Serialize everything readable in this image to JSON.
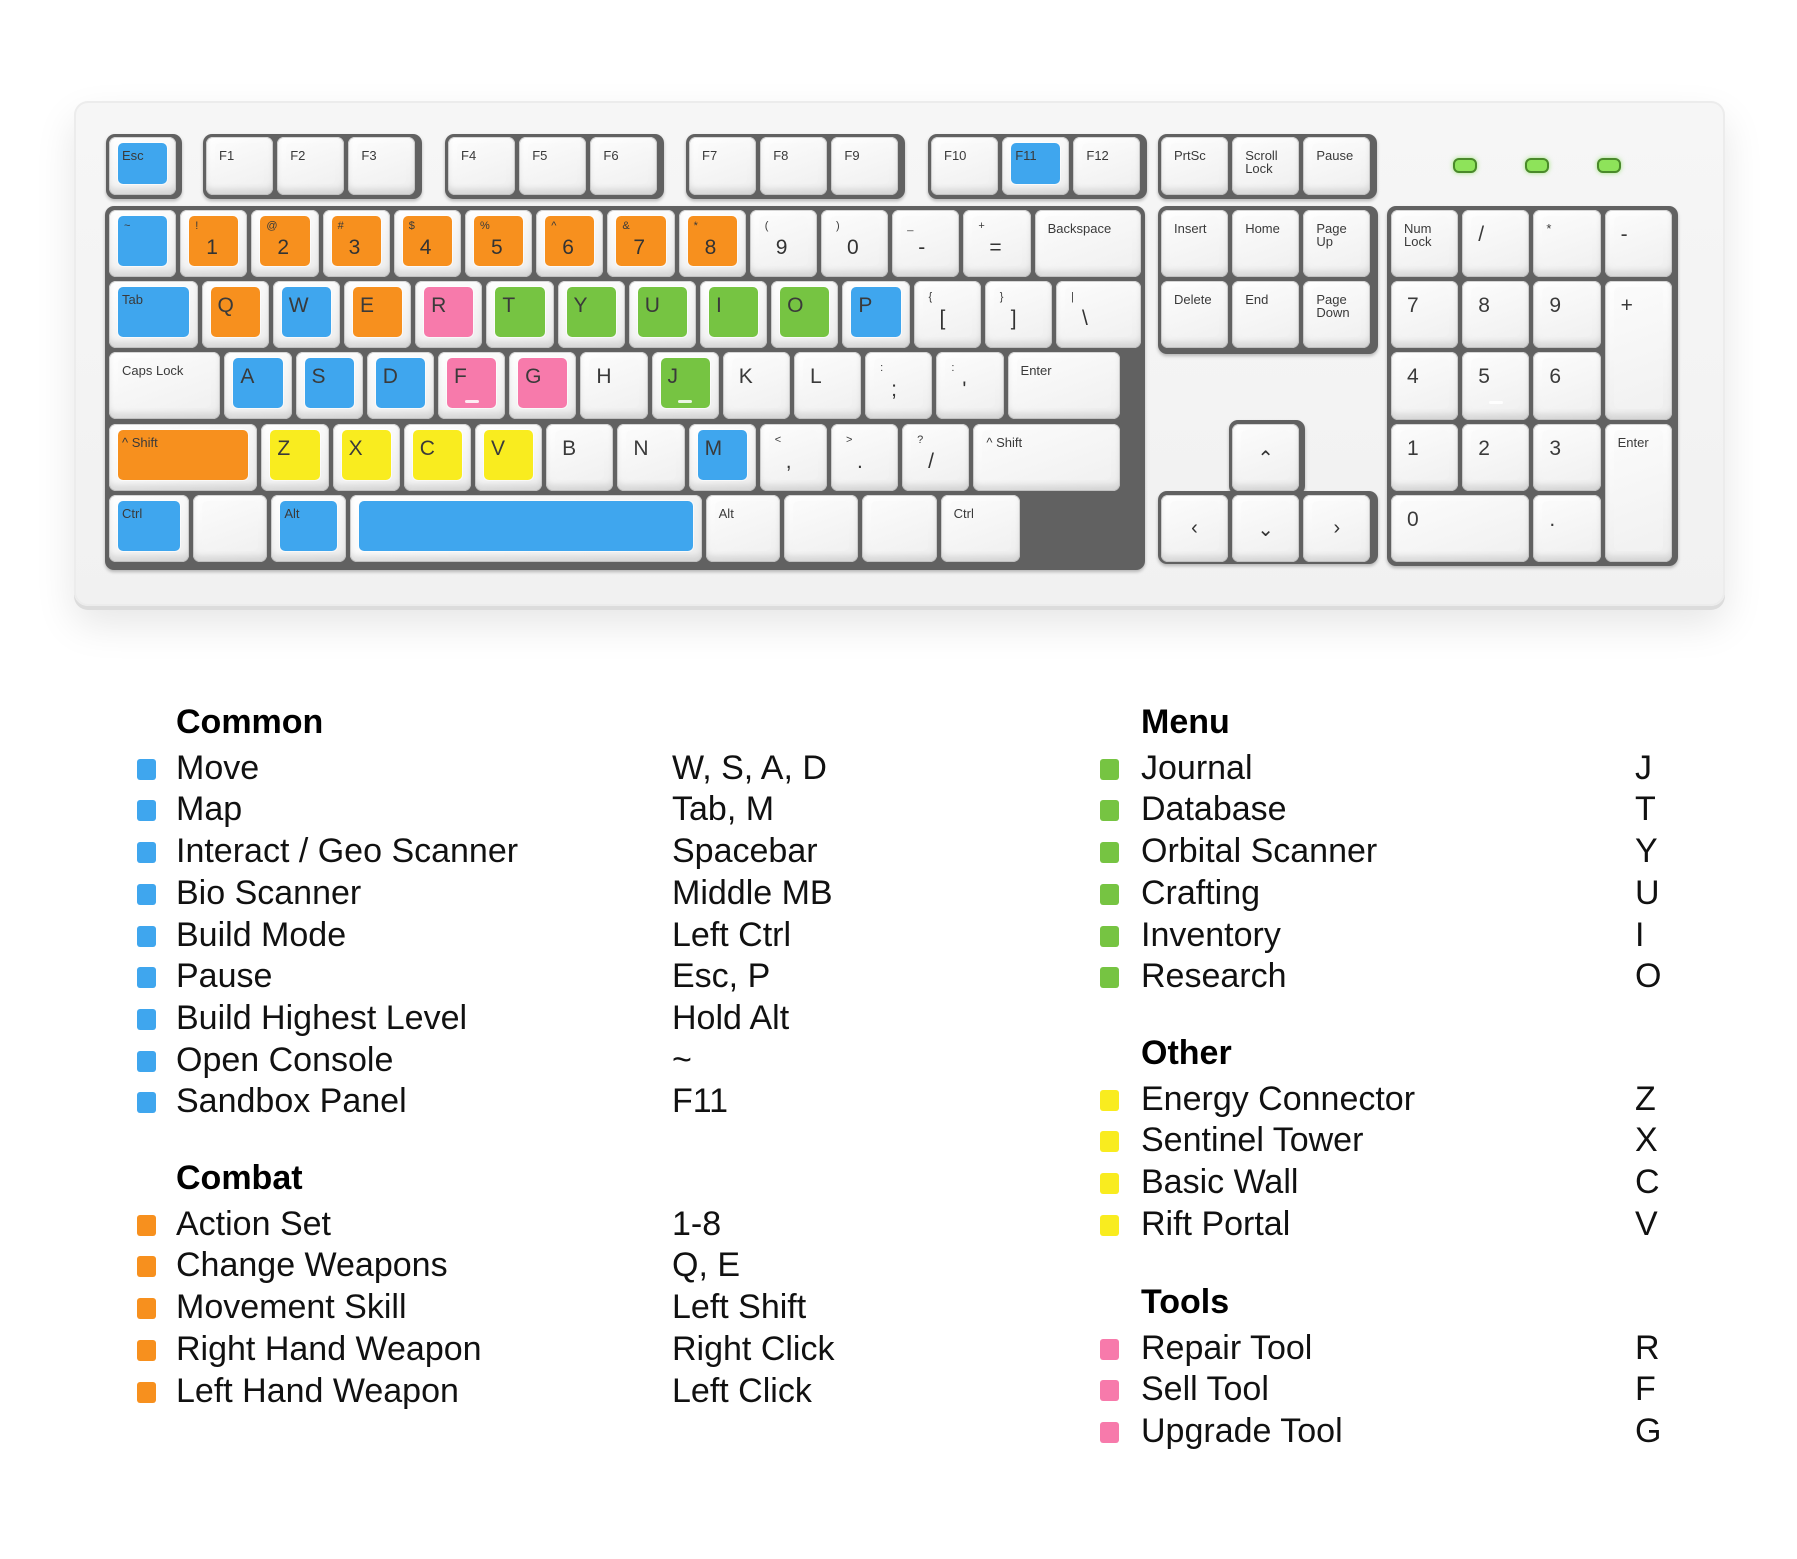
{
  "colors": {
    "blue": "#3fa6ee",
    "orange": "#f7901e",
    "green": "#76c442",
    "yellow": "#f9ec1f",
    "pink": "#f77aab",
    "default": ""
  },
  "keyboard": {
    "function_row": [
      {
        "id": "esc",
        "label": "Esc",
        "color": "blue"
      },
      {
        "id": "f1",
        "label": "F1"
      },
      {
        "id": "f2",
        "label": "F2"
      },
      {
        "id": "f3",
        "label": "F3"
      },
      {
        "id": "f4",
        "label": "F4"
      },
      {
        "id": "f5",
        "label": "F5"
      },
      {
        "id": "f6",
        "label": "F6"
      },
      {
        "id": "f7",
        "label": "F7"
      },
      {
        "id": "f8",
        "label": "F8"
      },
      {
        "id": "f9",
        "label": "F9"
      },
      {
        "id": "f10",
        "label": "F10"
      },
      {
        "id": "f11",
        "label": "F11",
        "color": "blue"
      },
      {
        "id": "f12",
        "label": "F12"
      },
      {
        "id": "prtsc",
        "label": "PrtSc"
      },
      {
        "id": "scroll-lock",
        "label": "Scroll\nLock"
      },
      {
        "id": "pause",
        "label": "Pause"
      }
    ],
    "number_row": [
      {
        "id": "tilde",
        "top": "~",
        "main": "",
        "color": "blue"
      },
      {
        "id": "1",
        "top": "!",
        "main": "1",
        "color": "orange"
      },
      {
        "id": "2",
        "top": "@",
        "main": "2",
        "color": "orange"
      },
      {
        "id": "3",
        "top": "#",
        "main": "3",
        "color": "orange"
      },
      {
        "id": "4",
        "top": "$",
        "main": "4",
        "color": "orange"
      },
      {
        "id": "5",
        "top": "%",
        "main": "5",
        "color": "orange"
      },
      {
        "id": "6",
        "top": "^",
        "main": "6",
        "color": "orange"
      },
      {
        "id": "7",
        "top": "&",
        "main": "7",
        "color": "orange"
      },
      {
        "id": "8",
        "top": "*",
        "main": "8",
        "color": "orange"
      },
      {
        "id": "9",
        "top": "(",
        "main": "9"
      },
      {
        "id": "0",
        "top": ")",
        "main": "0"
      },
      {
        "id": "minus",
        "top": "_",
        "main": "-"
      },
      {
        "id": "equals",
        "top": "+",
        "main": "="
      },
      {
        "id": "backspace",
        "label": "Backspace"
      }
    ],
    "qwerty_row": [
      {
        "id": "tab",
        "label": "Tab",
        "color": "blue"
      },
      {
        "id": "q",
        "big": "Q",
        "color": "orange"
      },
      {
        "id": "w",
        "big": "W",
        "color": "blue"
      },
      {
        "id": "e",
        "big": "E",
        "color": "orange"
      },
      {
        "id": "r",
        "big": "R",
        "color": "pink"
      },
      {
        "id": "t",
        "big": "T",
        "color": "green"
      },
      {
        "id": "y",
        "big": "Y",
        "color": "green"
      },
      {
        "id": "u",
        "big": "U",
        "color": "green"
      },
      {
        "id": "i",
        "big": "I",
        "color": "green"
      },
      {
        "id": "o",
        "big": "O",
        "color": "green"
      },
      {
        "id": "p",
        "big": "P",
        "color": "blue"
      },
      {
        "id": "lbracket",
        "top": "{",
        "main": "["
      },
      {
        "id": "rbracket",
        "top": "}",
        "main": "]"
      },
      {
        "id": "backslash",
        "top": "|",
        "main": "\\"
      }
    ],
    "home_row": [
      {
        "id": "caps-lock",
        "label": "Caps Lock"
      },
      {
        "id": "a",
        "big": "A",
        "color": "blue"
      },
      {
        "id": "s",
        "big": "S",
        "color": "blue"
      },
      {
        "id": "d",
        "big": "D",
        "color": "blue"
      },
      {
        "id": "f",
        "big": "F",
        "color": "pink",
        "bump": true
      },
      {
        "id": "g",
        "big": "G",
        "color": "pink"
      },
      {
        "id": "h",
        "big": "H"
      },
      {
        "id": "j",
        "big": "J",
        "color": "green",
        "bump": true
      },
      {
        "id": "k",
        "big": "K"
      },
      {
        "id": "l",
        "big": "L"
      },
      {
        "id": "semicolon",
        "top": ":",
        "main": ";"
      },
      {
        "id": "quote",
        "top": ":",
        "main": "'"
      },
      {
        "id": "enter",
        "label": "Enter"
      }
    ],
    "shift_row": [
      {
        "id": "left-shift",
        "label": "^ Shift",
        "color": "orange"
      },
      {
        "id": "z",
        "big": "Z",
        "color": "yellow"
      },
      {
        "id": "x",
        "big": "X",
        "color": "yellow"
      },
      {
        "id": "c",
        "big": "C",
        "color": "yellow"
      },
      {
        "id": "v",
        "big": "V",
        "color": "yellow"
      },
      {
        "id": "b",
        "big": "B"
      },
      {
        "id": "n",
        "big": "N"
      },
      {
        "id": "m",
        "big": "M",
        "color": "blue"
      },
      {
        "id": "comma",
        "top": "<",
        "main": ","
      },
      {
        "id": "period",
        "top": ">",
        "main": "."
      },
      {
        "id": "slash",
        "top": "?",
        "main": "/"
      },
      {
        "id": "right-shift",
        "label": "^ Shift"
      }
    ],
    "bottom_row": [
      {
        "id": "left-ctrl",
        "label": "Ctrl",
        "color": "blue"
      },
      {
        "id": "left-win",
        "label": ""
      },
      {
        "id": "left-alt",
        "label": "Alt",
        "color": "blue"
      },
      {
        "id": "spacebar",
        "label": "",
        "color": "blue"
      },
      {
        "id": "right-alt",
        "label": "Alt"
      },
      {
        "id": "right-win",
        "label": ""
      },
      {
        "id": "menu",
        "label": ""
      },
      {
        "id": "right-ctrl",
        "label": "Ctrl"
      }
    ],
    "nav_top": [
      {
        "id": "insert",
        "label": "Insert"
      },
      {
        "id": "home",
        "label": "Home"
      },
      {
        "id": "page-up",
        "label": "Page\nUp"
      },
      {
        "id": "delete",
        "label": "Delete"
      },
      {
        "id": "end",
        "label": "End"
      },
      {
        "id": "page-down",
        "label": "Page\nDown"
      }
    ],
    "arrows": [
      {
        "id": "up",
        "glyph": "^"
      },
      {
        "id": "left",
        "glyph": "<"
      },
      {
        "id": "down",
        "glyph": "v"
      },
      {
        "id": "right",
        "glyph": ">"
      }
    ],
    "numpad": [
      {
        "id": "num-lock",
        "label": "Num\nLock"
      },
      {
        "id": "num-divide",
        "big": "/"
      },
      {
        "id": "num-multiply",
        "label": "*"
      },
      {
        "id": "num-minus",
        "big": "-"
      },
      {
        "id": "num-7",
        "big": "7"
      },
      {
        "id": "num-8",
        "big": "8"
      },
      {
        "id": "num-9",
        "big": "9"
      },
      {
        "id": "num-plus",
        "big": "+"
      },
      {
        "id": "num-4",
        "big": "4"
      },
      {
        "id": "num-5",
        "big": "5",
        "bump": true
      },
      {
        "id": "num-6",
        "big": "6"
      },
      {
        "id": "num-1",
        "big": "1"
      },
      {
        "id": "num-2",
        "big": "2"
      },
      {
        "id": "num-3",
        "big": "3"
      },
      {
        "id": "num-enter",
        "label": "Enter"
      },
      {
        "id": "num-0",
        "big": "0"
      },
      {
        "id": "num-decimal",
        "big": "."
      }
    ],
    "leds": 3
  },
  "legend": {
    "left": [
      {
        "heading": "Common",
        "color": "blue",
        "items": [
          {
            "action": "Move",
            "key": "W, S, A, D"
          },
          {
            "action": "Map",
            "key": "Tab, M"
          },
          {
            "action": "Interact / Geo Scanner",
            "key": "Spacebar"
          },
          {
            "action": "Bio Scanner",
            "key": "Middle MB"
          },
          {
            "action": "Build Mode",
            "key": "Left Ctrl"
          },
          {
            "action": "Pause",
            "key": "Esc, P"
          },
          {
            "action": "Build Highest Level",
            "key": "Hold Alt"
          },
          {
            "action": "Open Console",
            "key": "~"
          },
          {
            "action": "Sandbox Panel",
            "key": "F11"
          }
        ]
      },
      {
        "heading": "Combat",
        "color": "orange",
        "items": [
          {
            "action": "Action Set",
            "key": "1-8"
          },
          {
            "action": "Change Weapons",
            "key": "Q, E"
          },
          {
            "action": "Movement Skill",
            "key": "Left Shift"
          },
          {
            "action": "Right Hand Weapon",
            "key": "Right Click"
          },
          {
            "action": "Left Hand Weapon",
            "key": "Left Click"
          }
        ]
      }
    ],
    "right": [
      {
        "heading": "Menu",
        "color": "green",
        "items": [
          {
            "action": "Journal",
            "key": "J"
          },
          {
            "action": "Database",
            "key": "T"
          },
          {
            "action": "Orbital Scanner",
            "key": "Y"
          },
          {
            "action": "Crafting",
            "key": "U"
          },
          {
            "action": "Inventory",
            "key": "I"
          },
          {
            "action": "Research",
            "key": "O"
          }
        ]
      },
      {
        "heading": "Other",
        "color": "yellow",
        "items": [
          {
            "action": "Energy Connector",
            "key": "Z"
          },
          {
            "action": "Sentinel Tower",
            "key": "X"
          },
          {
            "action": "Basic Wall",
            "key": "C"
          },
          {
            "action": "Rift Portal",
            "key": "V"
          }
        ]
      },
      {
        "heading": "Tools",
        "color": "pink",
        "items": [
          {
            "action": "Repair Tool",
            "key": "R"
          },
          {
            "action": "Sell Tool",
            "key": "F"
          },
          {
            "action": "Upgrade Tool",
            "key": "G"
          }
        ]
      }
    ]
  }
}
